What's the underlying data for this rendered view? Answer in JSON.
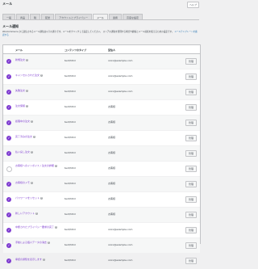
{
  "header": {
    "title": "メール",
    "help_label": "ヘルプ"
  },
  "tabs": [
    "一般",
    "商品",
    "税",
    "配送",
    "アカウントとプライバシー",
    "メール",
    "連携",
    "高度な設定"
  ],
  "active_tab": 5,
  "section": {
    "title": "メール通知",
    "description": "WooCommerce から送信されるメール通知は以下の通りです。メールをクリックして設定してください。",
    "description2": "ストアの通知を管理する場合や顧客とメール接続を使えるための設定です。",
    "link_text": "メールテンプレートを確認する"
  },
  "columns": {
    "email": "メール",
    "content_type": "コンテンツのタイプ",
    "recipient": "受信人"
  },
  "rows": [
    {
      "name": "新規注文",
      "enabled": true,
      "type": "text/html",
      "recipient": "xxxx@example.com"
    },
    {
      "name": "キャンセルされた注文",
      "enabled": true,
      "type": "text/html",
      "recipient": "xxxx@example.com"
    },
    {
      "name": "失敗注文",
      "enabled": true,
      "type": "text/html",
      "recipient": "xxxx@example.com"
    },
    {
      "name": "注文保留",
      "enabled": true,
      "type": "text/html",
      "recipient": "お客様"
    },
    {
      "name": "処理中の注文",
      "enabled": true,
      "type": "text/html",
      "recipient": "お客様"
    },
    {
      "name": "完了済みの注文",
      "enabled": true,
      "type": "text/html",
      "recipient": "お客様"
    },
    {
      "name": "払い戻し注文",
      "enabled": true,
      "type": "text/html",
      "recipient": "お客様"
    },
    {
      "name": "お客様へのインボイス / 注文の詳細",
      "enabled": false,
      "type": "text/html",
      "recipient": "お客様"
    },
    {
      "name": "お客様のメモ",
      "enabled": true,
      "type": "text/html",
      "recipient": "お客様"
    },
    {
      "name": "パスワードをリセット",
      "enabled": true,
      "type": "text/html",
      "recipient": "お客様"
    },
    {
      "name": "新しいアカウント",
      "enabled": true,
      "type": "text/html",
      "recipient": "お客様"
    },
    {
      "name": "中断されたプライバシー要求の完了",
      "enabled": true,
      "type": "text/html",
      "recipient": "xxxx@example.com"
    },
    {
      "name": "手動による個人データの消去",
      "enabled": true,
      "type": "text/html",
      "recipient": "xxxx@example.com"
    },
    {
      "name": "承認の通知を表示します",
      "enabled": true,
      "type": "text/html",
      "recipient": "xxxx@example.com"
    }
  ],
  "manage_label": "管理",
  "enabled_check": "✓",
  "help_glyph": "?",
  "colors": {
    "accent": "#7e3bd0",
    "background": "#f0f0f1"
  }
}
